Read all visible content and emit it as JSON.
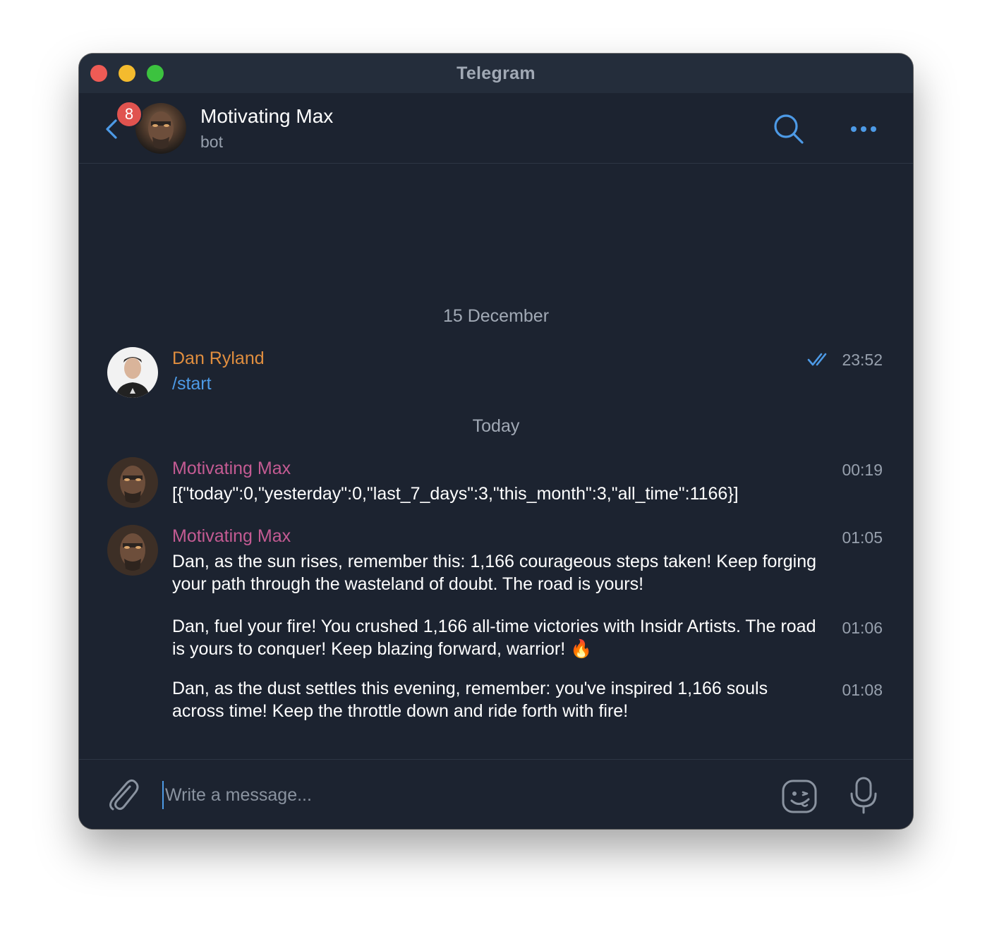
{
  "window": {
    "title": "Telegram"
  },
  "header": {
    "chat_name": "Motivating Max",
    "chat_status": "bot",
    "unread_badge": "8",
    "back_icon": "chevron-left-icon",
    "search_icon": "search-icon",
    "more_icon": "more-horizontal-icon"
  },
  "messages": {
    "date_separators": [
      "15 December",
      "Today"
    ],
    "items": [
      {
        "sender": "Dan Ryland",
        "text": "/start",
        "time": "23:52",
        "read": true
      },
      {
        "sender": "Motivating Max",
        "text": "[{\"today\":0,\"yesterday\":0,\"last_7_days\":3,\"this_month\":3,\"all_time\":1166}]",
        "time": "00:19"
      },
      {
        "sender": "Motivating Max",
        "text": "Dan, as the sun rises, remember this: 1,166 courageous steps taken! Keep forging your path through the wasteland of doubt. The road is yours!",
        "time": "01:05"
      },
      {
        "sender": "",
        "text": "Dan, fuel your fire! You crushed 1,166 all-time victories with Insidr Artists. The road is yours to conquer! Keep blazing forward, warrior! 🔥",
        "time": "01:06"
      },
      {
        "sender": "",
        "text": "Dan, as the dust settles this evening, remember: you've inspired 1,166 souls across time! Keep the throttle down and ride forth with fire!",
        "time": "01:08"
      }
    ]
  },
  "composer": {
    "placeholder": "Write a message...",
    "value": "",
    "attach_icon": "paperclip-icon",
    "sticker_icon": "sticker-icon",
    "mic_icon": "microphone-icon"
  },
  "colors": {
    "background": "#1c2330",
    "titlebar": "#242d3b",
    "accent": "#4d9ae6",
    "sender_dan": "#e08e3f",
    "sender_max": "#c45b93",
    "badge": "#e0534f"
  }
}
